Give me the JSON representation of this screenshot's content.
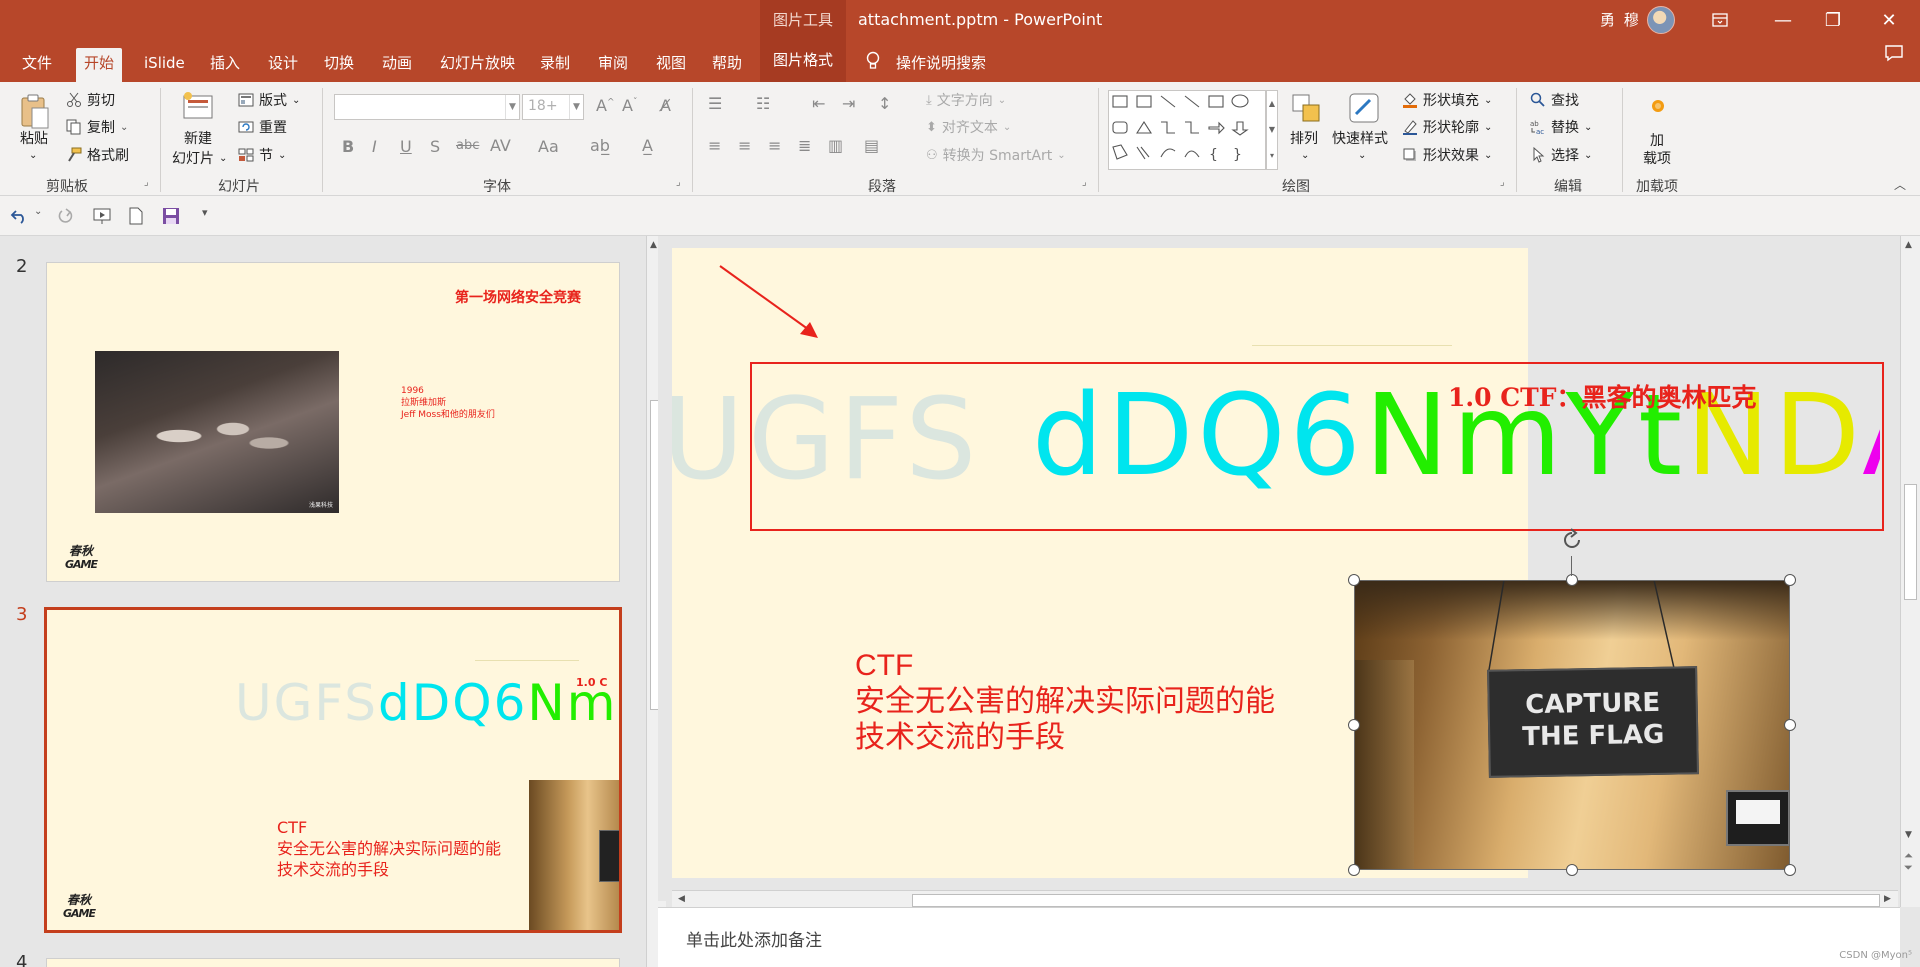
{
  "titlebar": {
    "context_tab": "图片工具",
    "doc_title": "attachment.pptm  -  PowerPoint",
    "user": "勇 穆",
    "minimize": "—",
    "restore": "❐",
    "close": "✕"
  },
  "menu": {
    "tabs": [
      "文件",
      "开始",
      "iSlide",
      "插入",
      "设计",
      "切换",
      "动画",
      "幻灯片放映",
      "录制",
      "审阅",
      "视图",
      "帮助"
    ],
    "picture_format": "图片格式",
    "search": "操作说明搜索"
  },
  "ribbon": {
    "clipboard": {
      "paste": "粘贴",
      "cut": "剪切",
      "copy": "复制",
      "format_painter": "格式刷",
      "label": "剪贴板"
    },
    "slides": {
      "new_slide_1": "新建",
      "new_slide_2": "幻灯片",
      "layout": "版式",
      "reset": "重置",
      "section": "节",
      "label": "幻灯片"
    },
    "font": {
      "size_value": "18+",
      "bold": "B",
      "italic": "I",
      "underline": "U",
      "shadow": "S",
      "strike": "abc",
      "spacing": "AV",
      "case": "Aa",
      "label": "字体"
    },
    "paragraph": {
      "text_direction": "文字方向",
      "align_text": "对齐文本",
      "smartart": "转换为 SmartArt",
      "label": "段落"
    },
    "drawing": {
      "arrange": "排列",
      "quick_styles": "快速样式",
      "shape_fill": "形状填充",
      "shape_outline": "形状轮廓",
      "shape_effects": "形状效果",
      "label": "绘图"
    },
    "editing": {
      "find": "查找",
      "replace": "替换",
      "select": "选择",
      "label": "编辑"
    },
    "addins": {
      "addin_1": "加",
      "addin_2": "载项",
      "label": "加载项"
    }
  },
  "thumbnails": {
    "slide2": {
      "num": "2",
      "title": "第一场网络安全竞赛",
      "lines": [
        "1996",
        "拉斯维加斯",
        "Jeff Moss和他的朋友们"
      ],
      "photo_watermark": "浅果科技",
      "logo_top": "春秋",
      "logo_bottom": "GAME"
    },
    "slide3": {
      "num": "3",
      "text_lines": [
        "CTF",
        "安全无公害的解决实际问题的能",
        "技术交流的手段"
      ],
      "heading_partial": "1.0  C",
      "logo_top": "春秋",
      "logo_bottom": "GAME"
    },
    "slide4": {
      "num": "4"
    }
  },
  "slide": {
    "heading": "1.0  CTF：黑客的奥林匹克",
    "cipher_chars": [
      {
        "c": "U",
        "color": "#dbe6df"
      },
      {
        "c": "G",
        "color": "#dbe6df"
      },
      {
        "c": "F",
        "color": "#dbe6df"
      },
      {
        "c": "S",
        "color": "#dbe6df"
      },
      {
        "c": "d",
        "color": "#00e5ee"
      },
      {
        "c": "D",
        "color": "#00e5ee"
      },
      {
        "c": "Q",
        "color": "#00e5ee"
      },
      {
        "c": "6",
        "color": "#00e5ee"
      },
      {
        "c": "N",
        "color": "#22ee00"
      },
      {
        "c": "m",
        "color": "#22ee00"
      },
      {
        "c": "Y",
        "color": "#22ee00"
      },
      {
        "c": "t",
        "color": "#22ee00"
      },
      {
        "c": "N",
        "color": "#e6ea00"
      },
      {
        "c": "D",
        "color": "#e6ea00"
      },
      {
        "c": "A",
        "color": "#ee00ee"
      },
      {
        "c": "=",
        "color": "#ee00ee"
      }
    ],
    "text_lines": [
      "CTF",
      "安全无公害的解决实际问题的能",
      "技术交流的手段"
    ],
    "photo_sign_1": "CAPTURE",
    "photo_sign_2": "THE FLAG"
  },
  "notes": {
    "placeholder": "单击此处添加备注"
  },
  "watermark": "CSDN @Myon⁵"
}
